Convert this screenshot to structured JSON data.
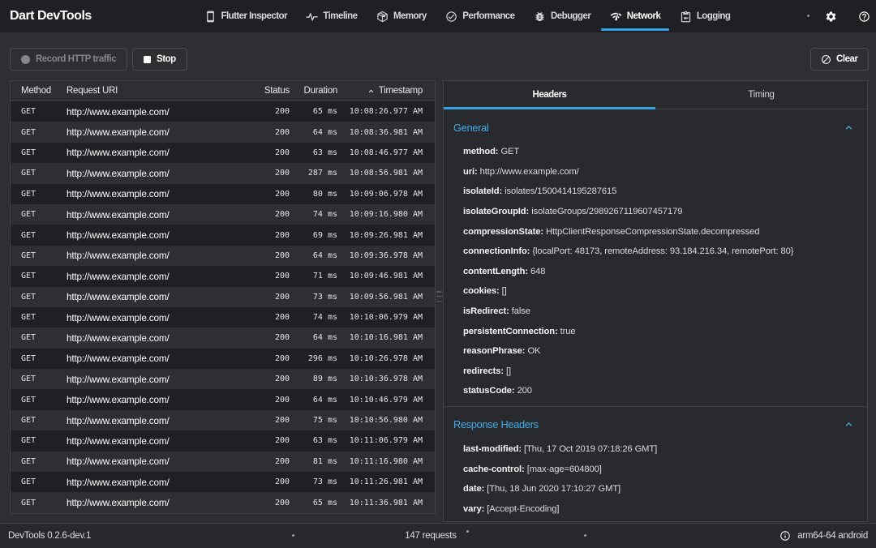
{
  "app_bar": {
    "title": "Dart DevTools",
    "tabs": [
      {
        "label": "Flutter Inspector",
        "icon": "smartphone-icon",
        "selected": false
      },
      {
        "label": "Timeline",
        "icon": "pulse-icon",
        "selected": false
      },
      {
        "label": "Memory",
        "icon": "package-icon",
        "selected": false
      },
      {
        "label": "Performance",
        "icon": "check-circle-icon",
        "selected": false
      },
      {
        "label": "Debugger",
        "icon": "bug-icon",
        "selected": false
      },
      {
        "label": "Network",
        "icon": "network-icon",
        "selected": true
      },
      {
        "label": "Logging",
        "icon": "clipboard-icon",
        "selected": false
      }
    ]
  },
  "toolbar": {
    "record_label": "Record HTTP traffic",
    "stop_label": "Stop",
    "clear_label": "Clear"
  },
  "requests_table": {
    "columns": {
      "method": "Method",
      "uri": "Request URI",
      "status": "Status",
      "duration": "Duration",
      "timestamp": "Timestamp"
    },
    "sort_column": "Timestamp",
    "sort_direction": "ascending",
    "rows": [
      {
        "method": "GET",
        "uri": "http://www.example.com/",
        "status": "200",
        "duration": "65 ms",
        "timestamp": "10:08:26.977 AM"
      },
      {
        "method": "GET",
        "uri": "http://www.example.com/",
        "status": "200",
        "duration": "64 ms",
        "timestamp": "10:08:36.981 AM"
      },
      {
        "method": "GET",
        "uri": "http://www.example.com/",
        "status": "200",
        "duration": "63 ms",
        "timestamp": "10:08:46.977 AM"
      },
      {
        "method": "GET",
        "uri": "http://www.example.com/",
        "status": "200",
        "duration": "287 ms",
        "timestamp": "10:08:56.981 AM"
      },
      {
        "method": "GET",
        "uri": "http://www.example.com/",
        "status": "200",
        "duration": "80 ms",
        "timestamp": "10:09:06.978 AM"
      },
      {
        "method": "GET",
        "uri": "http://www.example.com/",
        "status": "200",
        "duration": "74 ms",
        "timestamp": "10:09:16.980 AM"
      },
      {
        "method": "GET",
        "uri": "http://www.example.com/",
        "status": "200",
        "duration": "69 ms",
        "timestamp": "10:09:26.981 AM"
      },
      {
        "method": "GET",
        "uri": "http://www.example.com/",
        "status": "200",
        "duration": "64 ms",
        "timestamp": "10:09:36.978 AM"
      },
      {
        "method": "GET",
        "uri": "http://www.example.com/",
        "status": "200",
        "duration": "71 ms",
        "timestamp": "10:09:46.981 AM"
      },
      {
        "method": "GET",
        "uri": "http://www.example.com/",
        "status": "200",
        "duration": "73 ms",
        "timestamp": "10:09:56.981 AM"
      },
      {
        "method": "GET",
        "uri": "http://www.example.com/",
        "status": "200",
        "duration": "74 ms",
        "timestamp": "10:10:06.979 AM"
      },
      {
        "method": "GET",
        "uri": "http://www.example.com/",
        "status": "200",
        "duration": "64 ms",
        "timestamp": "10:10:16.981 AM"
      },
      {
        "method": "GET",
        "uri": "http://www.example.com/",
        "status": "200",
        "duration": "296 ms",
        "timestamp": "10:10:26.978 AM"
      },
      {
        "method": "GET",
        "uri": "http://www.example.com/",
        "status": "200",
        "duration": "89 ms",
        "timestamp": "10:10:36.978 AM"
      },
      {
        "method": "GET",
        "uri": "http://www.example.com/",
        "status": "200",
        "duration": "64 ms",
        "timestamp": "10:10:46.979 AM"
      },
      {
        "method": "GET",
        "uri": "http://www.example.com/",
        "status": "200",
        "duration": "75 ms",
        "timestamp": "10:10:56.980 AM"
      },
      {
        "method": "GET",
        "uri": "http://www.example.com/",
        "status": "200",
        "duration": "63 ms",
        "timestamp": "10:11:06.979 AM"
      },
      {
        "method": "GET",
        "uri": "http://www.example.com/",
        "status": "200",
        "duration": "81 ms",
        "timestamp": "10:11:16.980 AM"
      },
      {
        "method": "GET",
        "uri": "http://www.example.com/",
        "status": "200",
        "duration": "73 ms",
        "timestamp": "10:11:26.981 AM"
      },
      {
        "method": "GET",
        "uri": "http://www.example.com/",
        "status": "200",
        "duration": "65 ms",
        "timestamp": "10:11:36.981 AM"
      }
    ]
  },
  "details_panel": {
    "tabs": {
      "headers": "Headers",
      "timing": "Timing"
    },
    "active_tab": "Headers",
    "general_section": {
      "title": "General",
      "entries": [
        {
          "key": "method: ",
          "value": "GET"
        },
        {
          "key": "uri: ",
          "value": "http://www.example.com/"
        },
        {
          "key": "isolateId: ",
          "value": "isolates/1500414195287615"
        },
        {
          "key": "isolateGroupId: ",
          "value": "isolateGroups/2989267119607457179"
        },
        {
          "key": "compressionState: ",
          "value": "HttpClientResponseCompressionState.decompressed"
        },
        {
          "key": "connectionInfo: ",
          "value": "{localPort: 48173, remoteAddress: 93.184.216.34, remotePort: 80}"
        },
        {
          "key": "contentLength: ",
          "value": "648"
        },
        {
          "key": "cookies: ",
          "value": "[]"
        },
        {
          "key": "isRedirect: ",
          "value": "false"
        },
        {
          "key": "persistentConnection: ",
          "value": "true"
        },
        {
          "key": "reasonPhrase: ",
          "value": "OK"
        },
        {
          "key": "redirects: ",
          "value": "[]"
        },
        {
          "key": "statusCode: ",
          "value": "200"
        }
      ]
    },
    "response_headers_section": {
      "title": "Response Headers",
      "entries": [
        {
          "key": "last-modified: ",
          "value": "[Thu, 17 Oct 2019 07:18:26 GMT]"
        },
        {
          "key": "cache-control: ",
          "value": "[max-age=604800]"
        },
        {
          "key": "date: ",
          "value": "[Thu, 18 Jun 2020 17:10:27 GMT]"
        },
        {
          "key": "vary: ",
          "value": "[Accept-Encoding]"
        }
      ]
    }
  },
  "status_bar": {
    "version": "DevTools 0.2.6-dev.1",
    "requests_count": "147 requests",
    "device": "arm64-64 android"
  },
  "colors": {
    "accent_blue": "#35a3e2",
    "section_title_blue": "#43b4ef",
    "appbar_bg": "#1f2023",
    "page_bg": "#2e2f32",
    "row_dark": "#1f2023",
    "panel_bg": "#292a2d",
    "statusbar_bg": "#28292c"
  }
}
